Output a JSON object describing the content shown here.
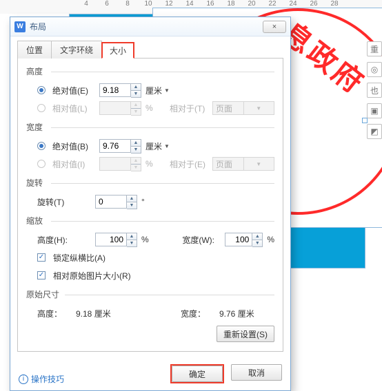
{
  "ruler": [
    "4",
    "6",
    "8",
    "10",
    "12",
    "14",
    "16",
    "18",
    "20",
    "22",
    "24",
    "26",
    "28"
  ],
  "seal_text": "息政府",
  "side": [
    "重",
    "◎",
    "也",
    "▣",
    "◩"
  ],
  "dialog": {
    "title": "布局",
    "close": "×",
    "tabs": {
      "position": "位置",
      "wrap": "文字环绕",
      "size": "大小"
    },
    "height": {
      "title": "高度",
      "abs_label": "绝对值(E)",
      "abs_value": "9.18",
      "abs_unit": "厘米",
      "rel_label": "相对值(L)",
      "rel_value": "",
      "rel_unit": "%",
      "rel_to_label": "相对于(T)",
      "rel_to_value": "页面"
    },
    "width": {
      "title": "宽度",
      "abs_label": "绝对值(B)",
      "abs_value": "9.76",
      "abs_unit": "厘米",
      "rel_label": "相对值(I)",
      "rel_value": "",
      "rel_unit": "%",
      "rel_to_label": "相对于(E)",
      "rel_to_value": "页面"
    },
    "rotate": {
      "title": "旋转",
      "label": "旋转(T)",
      "value": "0",
      "unit": "°"
    },
    "scale": {
      "title": "缩放",
      "h_label": "高度(H):",
      "h_value": "100",
      "h_unit": "%",
      "w_label": "宽度(W):",
      "w_value": "100",
      "w_unit": "%",
      "lock_label": "锁定纵横比(A)",
      "orig_label": "相对原始图片大小(R)"
    },
    "orig": {
      "title": "原始尺寸",
      "h_label": "高度：",
      "h_value": "9.18 厘米",
      "w_label": "宽度：",
      "w_value": "9.76 厘米",
      "reset": "重新设置(S)"
    },
    "help": "操作技巧",
    "ok": "确定",
    "cancel": "取消"
  }
}
